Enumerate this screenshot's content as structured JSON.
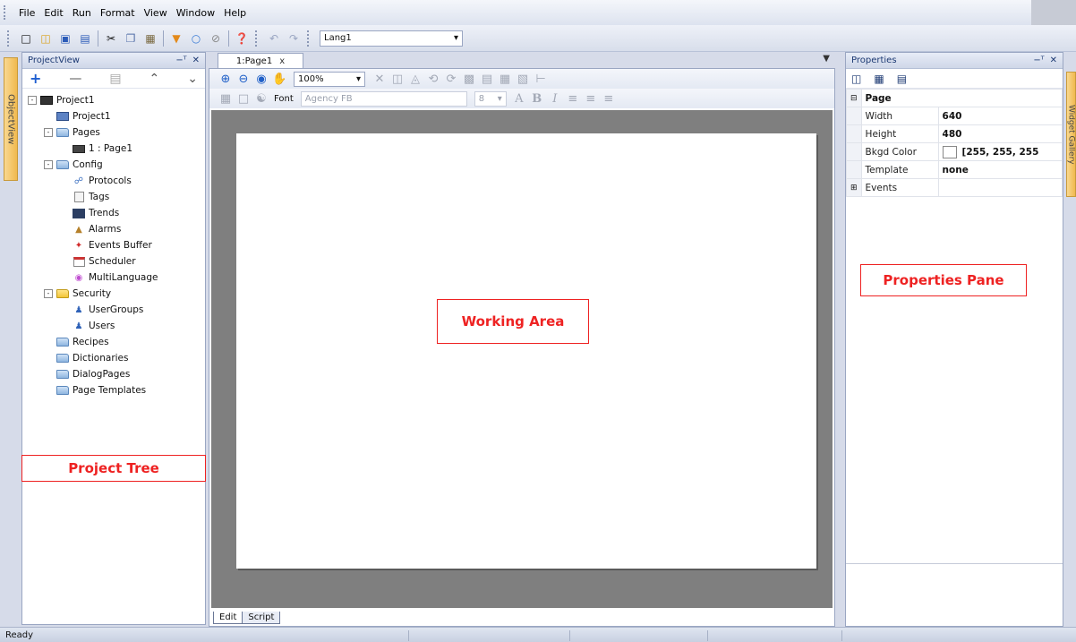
{
  "menu": {
    "items": [
      "File",
      "Edit",
      "Run",
      "Format",
      "View",
      "Window",
      "Help"
    ]
  },
  "toolbar": {
    "language": "Lang1"
  },
  "left_strip": {
    "objectview_label": "ObjectView"
  },
  "projectview": {
    "title": "ProjectView",
    "tree": [
      {
        "label": "Project1",
        "icon": "project-icon",
        "level": 0,
        "expander": "-"
      },
      {
        "label": "Project1",
        "icon": "project-settings-icon",
        "level": 1
      },
      {
        "label": "Pages",
        "icon": "folder-icon",
        "level": 1,
        "expander": "-"
      },
      {
        "label": "1 : Page1",
        "icon": "page-icon",
        "level": 2
      },
      {
        "label": "Config",
        "icon": "folder-icon",
        "level": 1,
        "expander": "-"
      },
      {
        "label": "Protocols",
        "icon": "protocols-icon",
        "level": 2
      },
      {
        "label": "Tags",
        "icon": "tags-icon",
        "level": 2
      },
      {
        "label": "Trends",
        "icon": "trends-icon",
        "level": 2
      },
      {
        "label": "Alarms",
        "icon": "alarms-icon",
        "level": 2
      },
      {
        "label": "Events Buffer",
        "icon": "events-buffer-icon",
        "level": 2
      },
      {
        "label": "Scheduler",
        "icon": "scheduler-icon",
        "level": 2
      },
      {
        "label": "MultiLanguage",
        "icon": "multilanguage-icon",
        "level": 2
      },
      {
        "label": "Security",
        "icon": "lock-folder-icon",
        "level": 1,
        "expander": "-"
      },
      {
        "label": "UserGroups",
        "icon": "usergroups-icon",
        "level": 2
      },
      {
        "label": "Users",
        "icon": "users-icon",
        "level": 2
      },
      {
        "label": "Recipes",
        "icon": "folder-icon",
        "level": 1
      },
      {
        "label": "Dictionaries",
        "icon": "folder-icon",
        "level": 1
      },
      {
        "label": "DialogPages",
        "icon": "folder-icon",
        "level": 1
      },
      {
        "label": "Page Templates",
        "icon": "folder-icon",
        "level": 1
      }
    ]
  },
  "labels": {
    "project_tree": "Project Tree",
    "working_area": "Working Area",
    "properties_pane": "Properties Pane"
  },
  "document": {
    "tab_label": "1:Page1",
    "tab_close": "x",
    "zoom": "100%",
    "font_label": "Font",
    "font_value": "Agency FB",
    "font_size": "8",
    "bottom_tabs": [
      "Edit",
      "Script"
    ]
  },
  "properties": {
    "title": "Properties",
    "category": "Page",
    "rows": [
      {
        "name": "Width",
        "value": "640"
      },
      {
        "name": "Height",
        "value": "480"
      },
      {
        "name": "Bkgd Color",
        "value": "[255, 255, 255"
      },
      {
        "name": "Template",
        "value": "none"
      }
    ],
    "events": "Events"
  },
  "right_strip": {
    "widget_label": "Widget Gallery"
  },
  "status": {
    "text": "Ready"
  },
  "colors": {
    "label_red": "#e22222",
    "canvas_grey": "#7f7f7f",
    "pane_bg": "#d6dbe9"
  }
}
